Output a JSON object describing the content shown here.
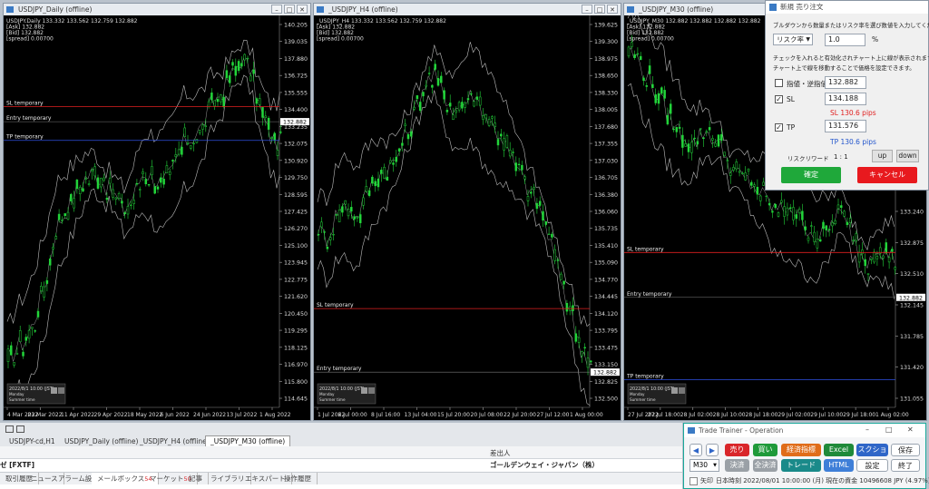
{
  "charts": [
    {
      "title": "USDJPY_Daily (offline)",
      "legend": [
        "USDJPY.Daily 133.332 133.562 132.759 132.882",
        "[Ask] 132.882",
        "[Bid] 132.882",
        "[spread] 0.00700"
      ],
      "price_ticks": [
        "140.205",
        "139.035",
        "137.880",
        "136.725",
        "135.555",
        "134.400",
        "133.235",
        "132.075",
        "130.920",
        "129.750",
        "128.595",
        "127.425",
        "126.270",
        "125.100",
        "123.945",
        "122.775",
        "121.620",
        "120.450",
        "119.295",
        "118.125",
        "116.970",
        "115.800",
        "114.645"
      ],
      "current_price": "132.882",
      "sl_label": "SL temporary",
      "entry_label": "Entry temporary",
      "tp_label": "TP temporary",
      "time_ticks": [
        "4 Mar 2022",
        "23 Mar 2022",
        "11 Apr 2022",
        "29 Apr 2022",
        "18 May 2022",
        "6 Jun 2022",
        "24 Jun 2022",
        "13 Jul 2022",
        "1 Aug 2022"
      ],
      "clock_lines": [
        "2022/8/1 10:00 (JST)",
        "Monday",
        "Summer time"
      ]
    },
    {
      "title": "_USDJPY_H4 (offline)",
      "legend": [
        "_USDJPY_H4 133.332 133.562 132.759 132.882",
        "[Ask] 132.882",
        "[Bid] 132.882",
        "[spread] 0.00700"
      ],
      "price_ticks": [
        "139.625",
        "139.300",
        "138.975",
        "138.650",
        "138.330",
        "138.005",
        "137.680",
        "137.355",
        "137.030",
        "136.705",
        "136.380",
        "136.060",
        "135.735",
        "135.410",
        "135.090",
        "134.770",
        "134.445",
        "134.120",
        "133.795",
        "133.475",
        "133.150",
        "132.825",
        "132.500"
      ],
      "current_price": "132.882",
      "sl_label": "SL temporary",
      "entry_label": "Entry temporary",
      "time_ticks": [
        "1 Jul 2022",
        "6 Jul 00:00",
        "8 Jul 16:00",
        "13 Jul 04:00",
        "15 Jul 20:00",
        "20 Jul 08:00",
        "22 Jul 20:00",
        "27 Jul 12:00",
        "1 Aug 00:00"
      ],
      "clock_lines": [
        "2022/8/1 10:00 (JST)",
        "Monday",
        "Summer time"
      ]
    },
    {
      "title": "_USDJPY_M30 (offline)",
      "legend": [
        "_USDJPY_M30 132.882 132.882 132.882 132.882",
        "[Ask] 132.882",
        "[Bid] 132.882",
        "[spread] 0.00700"
      ],
      "price_ticks": [
        "135.430",
        "135.060",
        "134.700",
        "134.335",
        "133.970",
        "133.605",
        "133.240",
        "132.875",
        "132.510",
        "132.145",
        "131.785",
        "131.420",
        "131.055"
      ],
      "current_price": "132.882",
      "sl_label": "SL temporary",
      "entry_label": "Entry temporary",
      "tp_label": "TP temporary",
      "time_ticks": [
        "27 Jul 2022",
        "27 Jul 18:00",
        "28 Jul 02:00",
        "28 Jul 10:00",
        "28 Jul 18:00",
        "29 Jul 02:00",
        "29 Jul 10:00",
        "29 Jul 18:00",
        "1 Aug 02:00"
      ],
      "clock_lines": [
        "2022/8/1 10:00 (JST)",
        "Monday",
        "Summer time"
      ]
    }
  ],
  "order_dialog": {
    "title": "新規 売り注文",
    "instruction": "ブルダウンから数量またはリスク率を選び数値を入力してください。",
    "mode_label": "リスク率",
    "mode_value": "1.0",
    "unit": "%",
    "note_line1": "チェックを入れると有効化されチャート上に線が表示されます。",
    "note_line2": "チャート上で線を移動することで価格を設定できます。",
    "limit_label": "指値・逆指値",
    "limit_value": "132.882",
    "sl_label": "SL",
    "sl_value": "134.188",
    "sl_pips": "SL 130.6 pips",
    "tp_label": "TP",
    "tp_value": "131.576",
    "tp_pips": "TP 130.6 pips",
    "rr_label": "リスクリワード",
    "rr_value": "1 : 1",
    "up_label": "up",
    "down_label": "down",
    "confirm_label": "確定",
    "cancel_label": "キャンセル",
    "colors": {
      "confirm": "#1fa83a",
      "cancel": "#e8191e",
      "pips": "#e02020",
      "tp_pips": "#2255cc"
    }
  },
  "chart_tabs": [
    "USDJPY-cd,H1",
    "USDJPY_Daily (offline)",
    "_USDJPY_H4 (offline)",
    "_USDJPY_M30 (offline)"
  ],
  "bottom_panel": {
    "left_text": "ゼ [FXTF]",
    "sender_header": "差出人",
    "sender": "ゴールデンウェイ・ジャパン（株）",
    "tabs": [
      "取引履歴",
      "ニュース",
      "アラーム設定",
      "メールボックス",
      "マーケット",
      "記事",
      "ライブラリ",
      "エキスパート",
      "操作履歴"
    ],
    "mail_count": "54",
    "market_count": "50"
  },
  "trade_trainer": {
    "title": "Trade Trainer - Operation",
    "prev_icon": "◀",
    "next_icon": "▶",
    "sell_label": "売り",
    "buy_label": "買い",
    "indicator_label": "経済指標",
    "excel_label": "Excel",
    "screenshot_label": "スクショ",
    "save_label": "保存",
    "timeframe": "M30",
    "settle_label": "決済",
    "settle_all_label": "全決済",
    "trend_label": "トレード",
    "html_label": "HTML",
    "settings_label": "設定",
    "exit_label": "終了",
    "status_check_label": "矢印",
    "status_text": "日本時刻 2022/08/01 10:00:00 (月)   現在の資金 10496608 JPY (4.97%)",
    "colors": {
      "sell": "#d9262a",
      "buy": "#1f9a3a",
      "indicator": "#e06d1a",
      "excel": "#1f8a3a",
      "screenshot": "#2f66c8",
      "settle": "#9aa0a6",
      "trend": "#1a8a8a",
      "html": "#3f7fd8"
    }
  }
}
